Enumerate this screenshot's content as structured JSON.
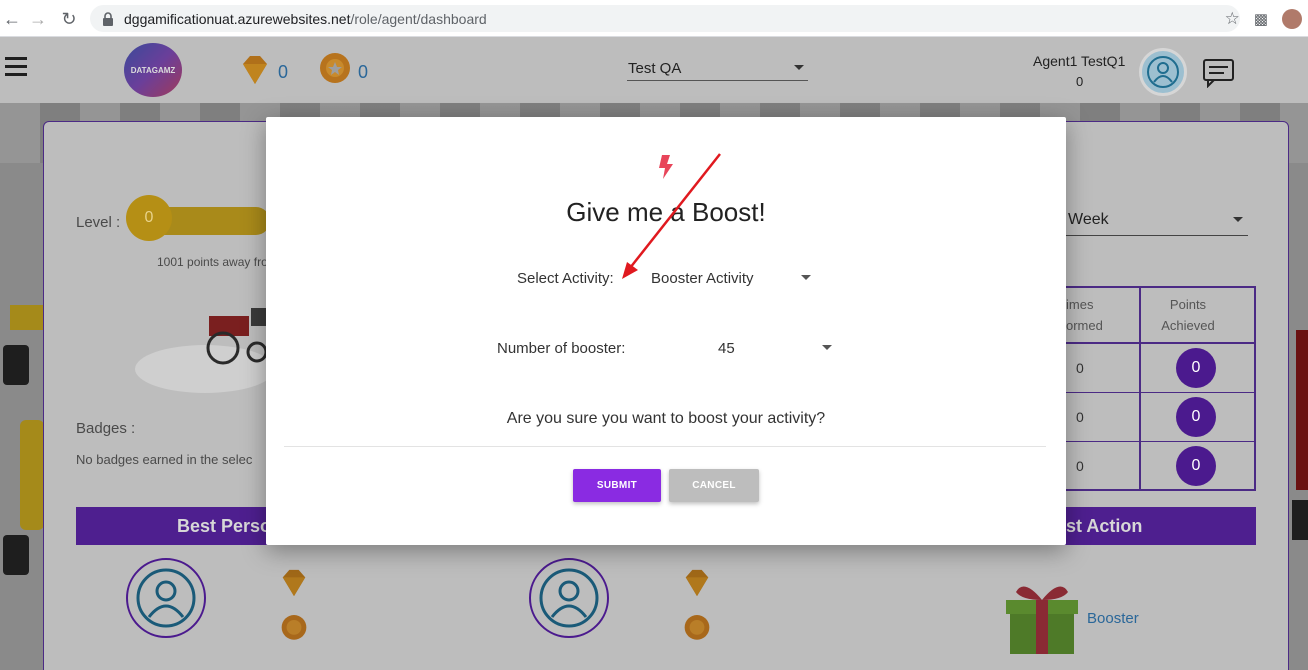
{
  "browser": {
    "url_host": "dggamificationuat.azurewebsites.net",
    "url_path": "/role/agent/dashboard"
  },
  "header": {
    "logo_text": "DATAGAMZ",
    "gems_count": "0",
    "medals_count": "0",
    "team_select": "Test QA",
    "user_name": "Agent1 TestQ1",
    "user_points": "0"
  },
  "dashboard": {
    "level_label": "Level :",
    "level_value": "0",
    "points_away": "1001 points away fro",
    "period_select": "Week",
    "badges_label": "Badges :",
    "badges_empty": "No badges earned in the selec",
    "table": {
      "col_times": [
        "imes",
        "ormed"
      ],
      "col_points": [
        "Points",
        "Achieved"
      ],
      "rows": [
        {
          "times": "0",
          "points": "0"
        },
        {
          "times": "0",
          "points": "0"
        },
        {
          "times": "0",
          "points": "0"
        }
      ]
    },
    "sections": {
      "best_person": "Best Perso",
      "best_action": "st Action",
      "booster_link": "Booster"
    }
  },
  "modal": {
    "title": "Give me a Boost!",
    "select_activity_label": "Select Activity:",
    "select_activity_value": "Booster Activity",
    "num_booster_label": "Number of booster:",
    "num_booster_value": "45",
    "confirm_text": "Are you sure you want to boost your activity?",
    "submit_label": "SUBMIT",
    "cancel_label": "CANCEL"
  },
  "colors": {
    "accent_purple": "#8a2be2",
    "annotation_red": "#e0191f"
  }
}
